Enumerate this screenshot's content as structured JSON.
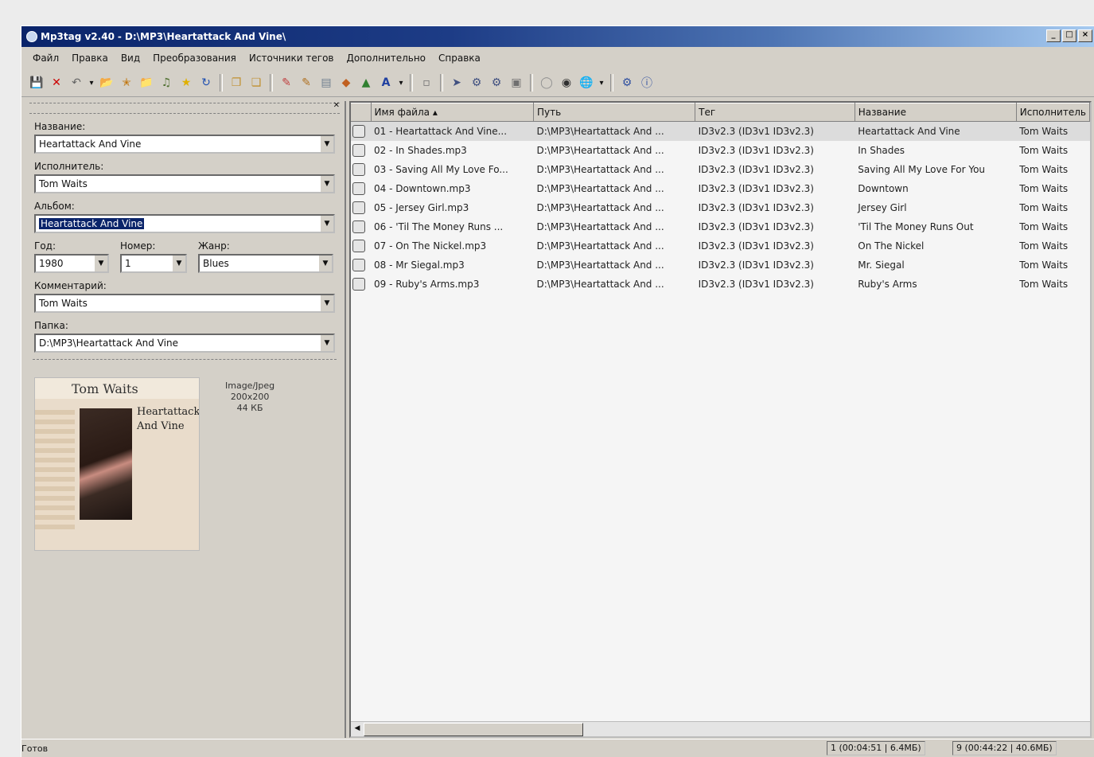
{
  "window": {
    "app_title": "Mp3tag v2.40",
    "path": "D:\\MP3\\Heartattack And Vine\\",
    "controls": [
      "_",
      "□",
      "×"
    ]
  },
  "menu": [
    "Файл",
    "Правка",
    "Вид",
    "Преобразования",
    "Источники тегов",
    "Дополнительно",
    "Справка"
  ],
  "toolbar_icons": [
    "save-icon",
    "remove-tag-icon",
    "undo-icon",
    "dropdown-icon",
    "open-folder-icon",
    "add-folder-icon",
    "folder-icon",
    "playlist-icon",
    "star-icon",
    "refresh-icon",
    "copy-tag-icon",
    "paste-tag-icon",
    "tag-filename-icon",
    "filename-tag-icon",
    "text-file-icon",
    "tag-tag-icon",
    "autonumber-icon",
    "case-convert-icon",
    "dropdown-icon",
    "export-icon",
    "actions-icon",
    "action-group-icon",
    "quick-action-icon",
    "tag-sources-icon",
    "freedb-icon",
    "amazon-icon",
    "web-source-icon",
    "dropdown-icon",
    "options-icon",
    "help-icon"
  ],
  "editor": {
    "title_label": "Название:",
    "title_value": "Heartattack And Vine",
    "artist_label": "Исполнитель:",
    "artist_value": "Tom Waits",
    "album_label": "Альбом:",
    "album_value": "Heartattack And Vine",
    "year_label": "Год:",
    "year_value": "1980",
    "track_label": "Номер:",
    "track_value": "1",
    "genre_label": "Жанр:",
    "genre_value": "Blues",
    "comment_label": "Комментарий:",
    "comment_value": "Tom Waits",
    "directory_label": "Папка:",
    "directory_value": "D:\\MP3\\Heartattack And Vine",
    "cover": {
      "artist_text": "Tom Waits",
      "album_text": "Heartattack And Vine",
      "info": [
        "Image/Jpeg",
        "200x200",
        "44 КБ"
      ]
    }
  },
  "table": {
    "columns": [
      "Имя файла",
      "Путь",
      "Тег",
      "Название",
      "Исполнитель"
    ],
    "rows": [
      [
        "01 - Heartattack And Vine...",
        "D:\\MP3\\Heartattack And ...",
        "ID3v2.3 (ID3v1 ID3v2.3)",
        "Heartattack And Vine",
        "Tom Waits"
      ],
      [
        "02 - In Shades.mp3",
        "D:\\MP3\\Heartattack And ...",
        "ID3v2.3 (ID3v1 ID3v2.3)",
        "In Shades",
        "Tom Waits"
      ],
      [
        "03 - Saving All My Love Fo...",
        "D:\\MP3\\Heartattack And ...",
        "ID3v2.3 (ID3v1 ID3v2.3)",
        "Saving All My Love For You",
        "Tom Waits"
      ],
      [
        "04 - Downtown.mp3",
        "D:\\MP3\\Heartattack And ...",
        "ID3v2.3 (ID3v1 ID3v2.3)",
        "Downtown",
        "Tom Waits"
      ],
      [
        "05 - Jersey Girl.mp3",
        "D:\\MP3\\Heartattack And ...",
        "ID3v2.3 (ID3v1 ID3v2.3)",
        "Jersey Girl",
        "Tom Waits"
      ],
      [
        "06 - 'Til The Money Runs ...",
        "D:\\MP3\\Heartattack And ...",
        "ID3v2.3 (ID3v1 ID3v2.3)",
        "'Til The Money Runs Out",
        "Tom Waits"
      ],
      [
        "07 - On The Nickel.mp3",
        "D:\\MP3\\Heartattack And ...",
        "ID3v2.3 (ID3v1 ID3v2.3)",
        "On The Nickel",
        "Tom Waits"
      ],
      [
        "08 - Mr Siegal.mp3",
        "D:\\MP3\\Heartattack And ...",
        "ID3v2.3 (ID3v1 ID3v2.3)",
        "Mr. Siegal",
        "Tom Waits"
      ],
      [
        "09 - Ruby's Arms.mp3",
        "D:\\MP3\\Heartattack And ...",
        "ID3v2.3 (ID3v1 ID3v2.3)",
        "Ruby's Arms",
        "Tom Waits"
      ]
    ]
  },
  "status": {
    "text": "Готов",
    "selected": "1 (00:04:51 | 6.4МБ)",
    "total": "9 (00:44:22 | 40.6МБ)"
  }
}
